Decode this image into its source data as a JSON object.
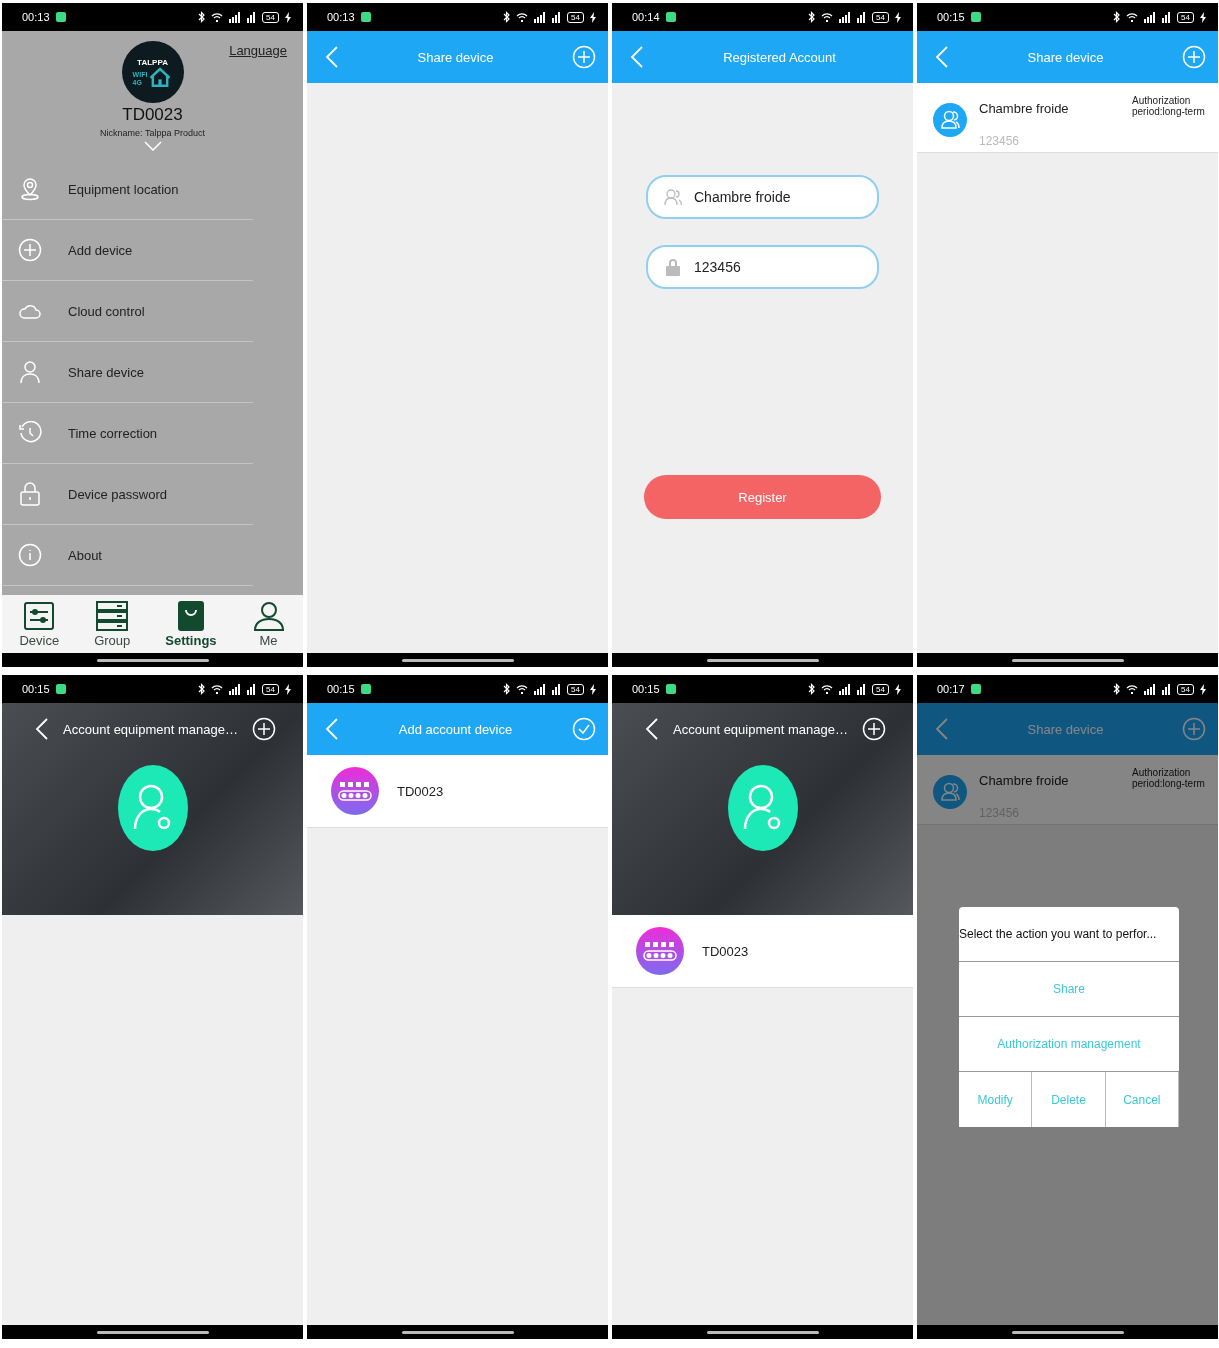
{
  "screens": [
    {
      "kind": "menu",
      "status": {
        "time": "00:13",
        "battery": "54"
      },
      "logo": {
        "title": "TALPPA",
        "tags": [
          "WIFI",
          "4G"
        ]
      },
      "language": "Language",
      "device_name": "TD0023",
      "nickname": "Nickname:  Talppa Product",
      "menu": [
        {
          "label": "Equipment location"
        },
        {
          "label": "Add device"
        },
        {
          "label": "Cloud control"
        },
        {
          "label": "Share device"
        },
        {
          "label": "Time correction"
        },
        {
          "label": "Device password"
        },
        {
          "label": "About"
        }
      ],
      "tabs": [
        {
          "label": "Device",
          "selected": false
        },
        {
          "label": "Group",
          "selected": false
        },
        {
          "label": "Settings",
          "selected": true
        },
        {
          "label": "Me",
          "selected": false
        }
      ]
    },
    {
      "kind": "share_list",
      "status": {
        "time": "00:13",
        "battery": "54"
      },
      "title": "Share device"
    },
    {
      "kind": "register",
      "status": {
        "time": "00:14",
        "battery": "54"
      },
      "title": "Registered Account",
      "fields": [
        {
          "value": "Chambre froide"
        },
        {
          "value": "123456"
        }
      ],
      "button": "Register"
    },
    {
      "kind": "share_list",
      "status": {
        "time": "00:15",
        "battery": "54"
      },
      "title": "Share device",
      "items": [
        {
          "name": "Chambre froide",
          "account": "123456",
          "period": "Authorization period:long-term"
        }
      ]
    },
    {
      "kind": "account_manage",
      "status": {
        "time": "00:15",
        "battery": "54"
      },
      "title": "Account equipment manage…"
    },
    {
      "kind": "add_device",
      "status": {
        "time": "00:15",
        "battery": "54"
      },
      "title": "Add account device",
      "devices": [
        {
          "name": "TD0023"
        }
      ]
    },
    {
      "kind": "account_manage",
      "status": {
        "time": "00:15",
        "battery": "54"
      },
      "title": "Account equipment manage…",
      "devices": [
        {
          "name": "TD0023"
        }
      ]
    },
    {
      "kind": "share_list",
      "status": {
        "time": "00:17",
        "battery": "54"
      },
      "title": "Share device",
      "items": [
        {
          "name": "Chambre froide",
          "account": "123456",
          "period": "Authorization period:long-term"
        }
      ],
      "dialog": {
        "title": "Select the action you want to perfor...",
        "actions": [
          "Share",
          "Authorization management"
        ],
        "buttons": [
          "Modify",
          "Delete",
          "Cancel"
        ]
      }
    }
  ]
}
